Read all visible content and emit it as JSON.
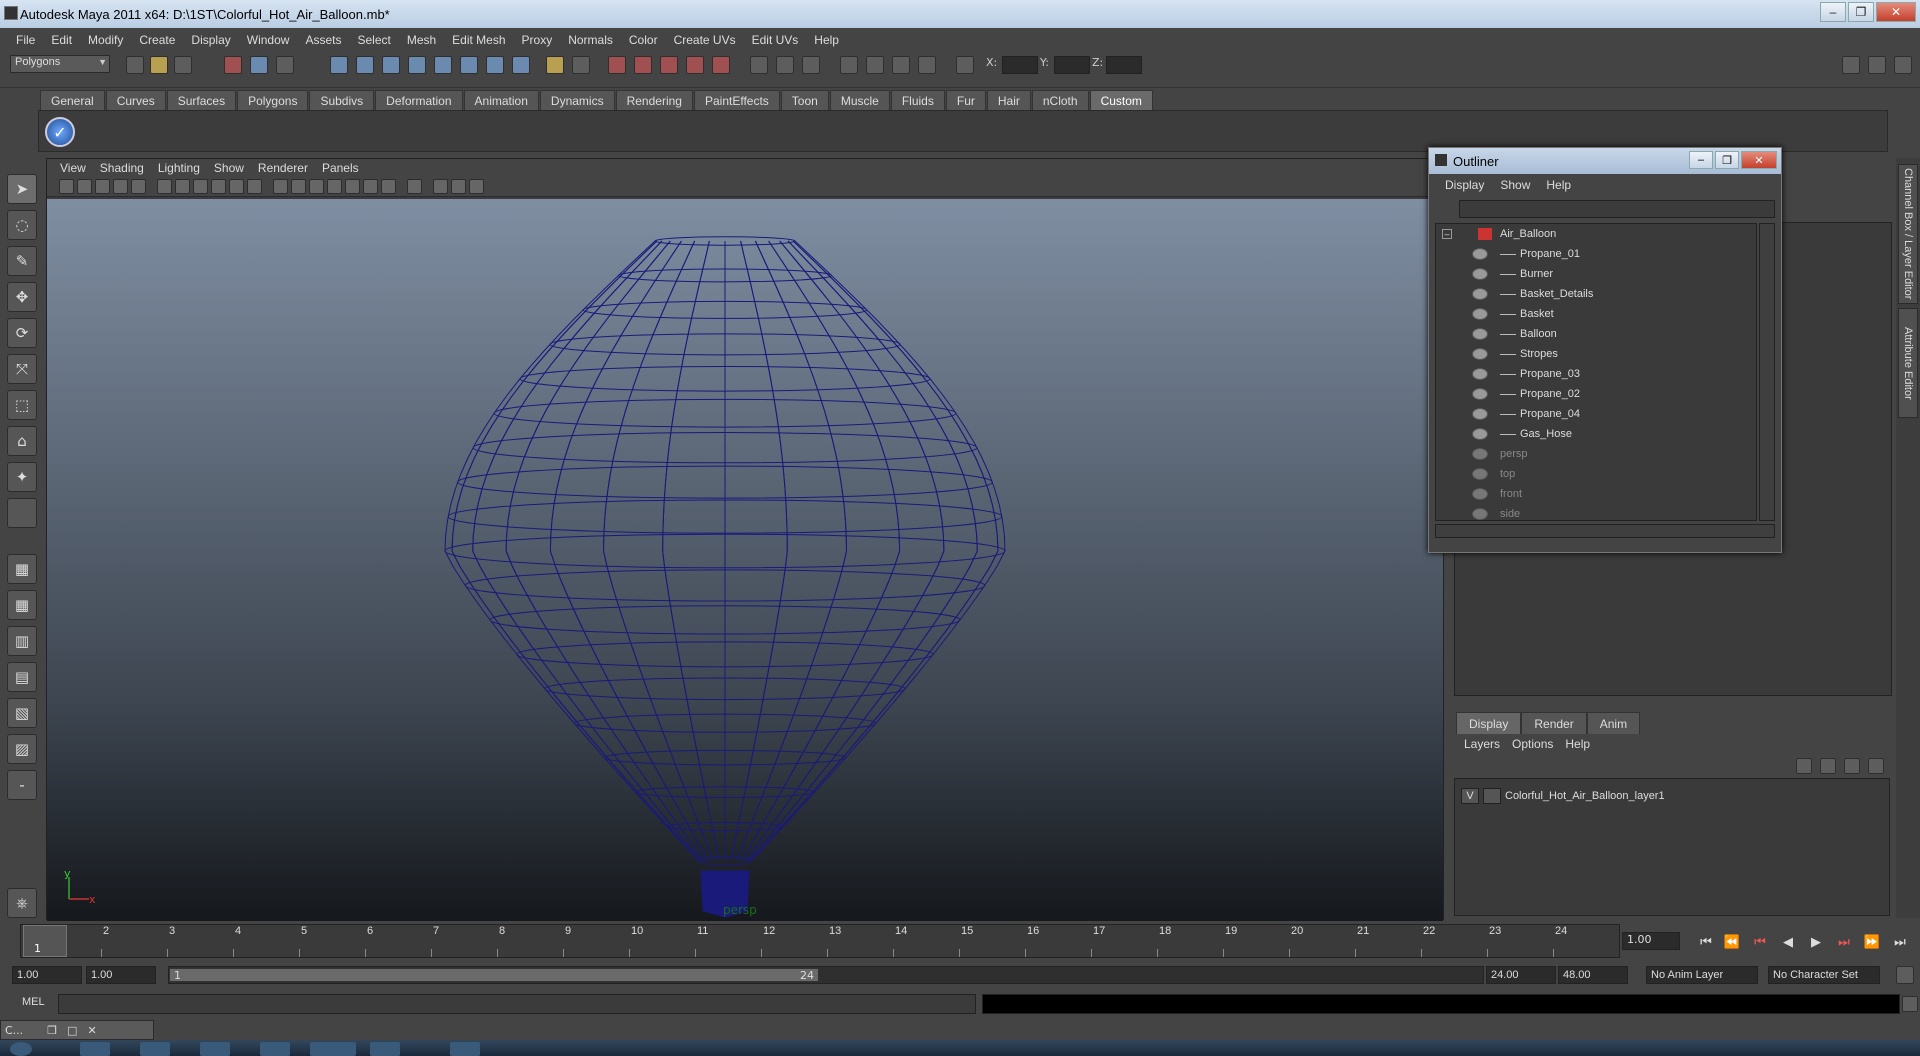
{
  "window": {
    "title": "Autodesk Maya 2011 x64: D:\\1ST\\Colorful_Hot_Air_Balloon.mb*"
  },
  "menubar": [
    "File",
    "Edit",
    "Modify",
    "Create",
    "Display",
    "Window",
    "Assets",
    "Select",
    "Mesh",
    "Edit Mesh",
    "Proxy",
    "Normals",
    "Color",
    "Create UVs",
    "Edit UVs",
    "Help"
  ],
  "statusline": {
    "mode": "Polygons",
    "x_label": "X:",
    "y_label": "Y:",
    "z_label": "Z:"
  },
  "shelf_tabs": [
    "General",
    "Curves",
    "Surfaces",
    "Polygons",
    "Subdivs",
    "Deformation",
    "Animation",
    "Dynamics",
    "Rendering",
    "PaintEffects",
    "Toon",
    "Muscle",
    "Fluids",
    "Fur",
    "Hair",
    "nCloth",
    "Custom"
  ],
  "shelf_active": "Custom",
  "viewport": {
    "menu": [
      "View",
      "Shading",
      "Lighting",
      "Show",
      "Renderer",
      "Panels"
    ],
    "camera": "persp",
    "axis_y": "y",
    "axis_x": "x",
    "wire_color": "#1a1a7a"
  },
  "outliner": {
    "title": "Outliner",
    "menu": [
      "Display",
      "Show",
      "Help"
    ],
    "root": "Air_Balloon",
    "children": [
      "Propane_01",
      "Burner",
      "Basket_Details",
      "Basket",
      "Balloon",
      "Stropes",
      "Propane_03",
      "Propane_02",
      "Propane_04",
      "Gas_Hose"
    ],
    "cameras": [
      "persp",
      "top",
      "front",
      "side"
    ]
  },
  "layers": {
    "tabs": [
      "Display",
      "Render",
      "Anim"
    ],
    "active_tab": "Display",
    "menu": [
      "Layers",
      "Options",
      "Help"
    ],
    "rows": [
      {
        "visible": "V",
        "name": "Colorful_Hot_Air_Balloon_layer1"
      }
    ]
  },
  "side_tabs": [
    "Channel Box / Layer Editor",
    "Attribute Editor"
  ],
  "timeslider": {
    "ticks": [
      "1",
      "2",
      "3",
      "4",
      "5",
      "6",
      "7",
      "8",
      "9",
      "10",
      "11",
      "12",
      "13",
      "14",
      "15",
      "16",
      "17",
      "18",
      "19",
      "20",
      "21",
      "22",
      "23",
      "24"
    ],
    "current_frame_marker": "1",
    "current_frame": "1.00"
  },
  "range": {
    "start": "1.00",
    "playback_start": "1.00",
    "handle_start": "1",
    "handle_end": "24",
    "playback_end": "24.00",
    "end": "48.00",
    "anim_layer": "No Anim Layer",
    "char_set": "No Character Set"
  },
  "cmdline": {
    "label": "MEL"
  },
  "minimized": {
    "label": "C..."
  }
}
